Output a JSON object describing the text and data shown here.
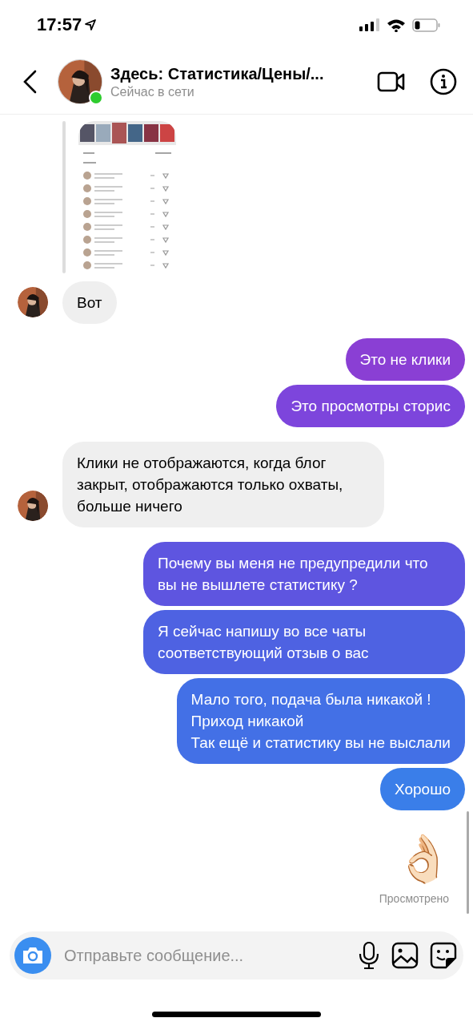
{
  "status_bar": {
    "time": "17:57"
  },
  "header": {
    "title": "Здесь: Статистика/Цены/...",
    "subtitle": "Сейчас в сети",
    "online": true
  },
  "messages": [
    {
      "kind": "incoming",
      "text": "Вот"
    },
    {
      "kind": "outgoing",
      "text": "Это не клики",
      "color": "#8a3fd4"
    },
    {
      "kind": "outgoing",
      "text": "Это просмотры сторис",
      "color": "#7d45dc"
    },
    {
      "kind": "incoming",
      "text": "Клики не отображаются, когда блог закрыт, отображаются только охваты, больше ничего"
    },
    {
      "kind": "outgoing",
      "text": "Почему вы меня не предупредили что вы не вышлете статистику ?",
      "color": "#5e55e0"
    },
    {
      "kind": "outgoing",
      "text": "Я сейчас напишу во все чаты соответствующий отзыв о вас",
      "color": "#4e62e2"
    },
    {
      "kind": "outgoing",
      "text": "Мало того, подача была никакой !\nПриход никакой\nТак ещё и статистику вы не выслали",
      "color": "#4370e6"
    },
    {
      "kind": "outgoing",
      "text": "Хорошо",
      "color": "#3a7ee9"
    },
    {
      "kind": "emoji",
      "text": "👌🏻"
    }
  ],
  "seen": "Просмотрено",
  "composer": {
    "placeholder": "Отправьте сообщение..."
  }
}
